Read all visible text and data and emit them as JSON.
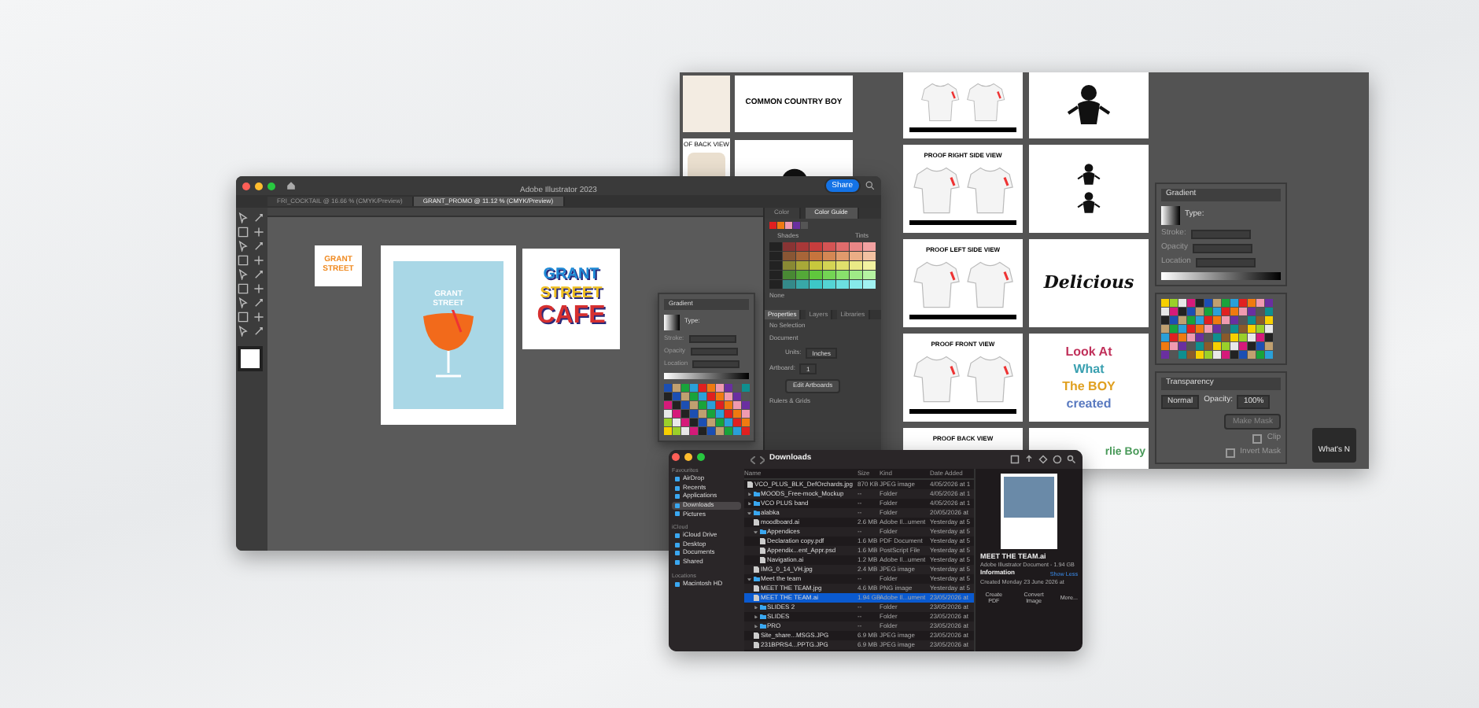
{
  "artboard_window": {
    "left_sheets": [
      {
        "kind": "title",
        "text": "COMMON COUNTRY BOY"
      },
      {
        "kind": "back",
        "text": "OF BACK VIEW"
      }
    ],
    "proof_sheets": [
      {
        "kind": "cut"
      },
      {
        "kind": "titled",
        "title": "PROOF RIGHT SIDE VIEW"
      },
      {
        "kind": "titled",
        "title": "PROOF LEFT SIDE VIEW"
      },
      {
        "kind": "titled",
        "title": "PROOF FRONT VIEW"
      },
      {
        "kind": "titled",
        "title": "PROOF BACK VIEW"
      }
    ],
    "art_sheets": [
      {
        "kind": "figure"
      },
      {
        "kind": "figures"
      },
      {
        "kind": "script",
        "lines": [
          "Delicious"
        ]
      },
      {
        "kind": "lettering",
        "lines": [
          "Look At",
          "What",
          "The BOY",
          "created"
        ]
      },
      {
        "kind": "cut-lettering",
        "lines": [
          "rlie Boy"
        ]
      }
    ],
    "gradient_panel": {
      "title": "Gradient",
      "labels": [
        "Type:",
        "Stroke:",
        "Opacity",
        "Location"
      ]
    },
    "transparency_panel": {
      "title": "Transparency",
      "blend": "Normal",
      "opacity_label": "Opacity:",
      "opacity": "100%",
      "make_mask": "Make Mask",
      "options": [
        {
          "label": "Clip",
          "checked": false
        },
        {
          "label": "Invert Mask",
          "checked": false
        }
      ]
    },
    "tooltip": "What's N"
  },
  "illustrator": {
    "title": "Adobe Illustrator 2023",
    "share": "Share",
    "tabs": [
      {
        "label": "FRI_COCKTAIL @ 16.66 % (CMYK/Preview)",
        "selected": false
      },
      {
        "label": "GRANT_PROMO @ 11.12 % (CMYK/Preview)",
        "selected": true
      }
    ],
    "artboards": [
      {
        "kind": "badge",
        "lines": [
          "GRANT",
          "STREET"
        ]
      },
      {
        "kind": "poster",
        "lines": [
          "GRANT",
          "STREET"
        ]
      },
      {
        "kind": "logo",
        "lines": [
          "GRANT",
          "STREET",
          "CAFE"
        ]
      }
    ],
    "color_tabs": [
      {
        "label": "Color",
        "selected": false
      },
      {
        "label": "Color Guide",
        "selected": true
      }
    ],
    "guide_labels": [
      "Shades",
      "Tints"
    ],
    "none_label": "None",
    "property_tabs": [
      {
        "label": "Properties",
        "selected": true
      },
      {
        "label": "Layers",
        "selected": false
      },
      {
        "label": "Libraries",
        "selected": false
      }
    ],
    "properties": {
      "selection": "No Selection",
      "section": "Document",
      "units_label": "Units:",
      "units": "Inches",
      "artboard_label": "Artboard:",
      "artboard": "1",
      "edit": "Edit Artboards",
      "rulers": "Rulers & Grids"
    },
    "gradient_float": {
      "title": "Gradient",
      "labels": [
        "Type:",
        "Stroke:",
        "Opacity",
        "Location"
      ]
    }
  },
  "finder": {
    "title": "Downloads",
    "sidebar": [
      {
        "heading": "Favourites",
        "items": [
          {
            "label": "AirDrop",
            "selected": false
          },
          {
            "label": "Recents",
            "selected": false
          },
          {
            "label": "Applications",
            "selected": false
          },
          {
            "label": "Downloads",
            "selected": true
          },
          {
            "label": "Pictures",
            "selected": false
          }
        ]
      },
      {
        "heading": "iCloud",
        "items": [
          {
            "label": "iCloud Drive",
            "selected": false
          },
          {
            "label": "Desktop",
            "selected": false
          },
          {
            "label": "Documents",
            "selected": false
          },
          {
            "label": "Shared",
            "selected": false
          }
        ]
      },
      {
        "heading": "Locations",
        "items": [
          {
            "label": "Macintosh HD",
            "selected": false
          }
        ]
      }
    ],
    "columns": [
      "Name",
      "Size",
      "Kind",
      "Date Added"
    ],
    "rows": [
      {
        "name": "VCO_PLUS_BLK_DefOrchards.jpg",
        "size": "870 KB",
        "type": "JPEG image",
        "date": "4/05/2026 at 1",
        "kind": "file",
        "selected": false
      },
      {
        "name": "MOODS_Free-mock_Mockup",
        "size": "--",
        "type": "Folder",
        "date": "4/05/2026 at 1",
        "kind": "folder",
        "expanded": false,
        "selected": false
      },
      {
        "name": "VCO PLUS band",
        "size": "--",
        "type": "Folder",
        "date": "4/05/2026 at 1",
        "kind": "folder",
        "expanded": false,
        "selected": false
      },
      {
        "name": "alabka",
        "size": "--",
        "type": "Folder",
        "date": "20/05/2026 at",
        "kind": "folder",
        "expanded": true,
        "selected": false,
        "children": [
          {
            "name": "moodboard.ai",
            "size": "2.6 MB",
            "type": "Adobe Il...ument",
            "date": "Yesterday at 5",
            "kind": "file",
            "selected": false
          },
          {
            "name": "Appendices",
            "size": "--",
            "type": "Folder",
            "date": "Yesterday at 5",
            "kind": "folder",
            "expanded": true,
            "selected": false,
            "children": [
              {
                "name": "Declaration copy.pdf",
                "size": "1.6 MB",
                "type": "PDF Document",
                "date": "Yesterday at 5",
                "kind": "file",
                "selected": false
              },
              {
                "name": "Appendix...ent_Appr.psd",
                "size": "1.6 MB",
                "type": "PostScript File",
                "date": "Yesterday at 5",
                "kind": "file",
                "selected": false
              },
              {
                "name": "Navigation.ai",
                "size": "1.2 MB",
                "type": "Adobe Il...ument",
                "date": "Yesterday at 5",
                "kind": "file",
                "selected": false
              }
            ]
          },
          {
            "name": "IMG_0_14_VH.jpg",
            "size": "2.4 MB",
            "type": "JPEG image",
            "date": "Yesterday at 5",
            "kind": "file",
            "selected": false
          }
        ]
      },
      {
        "name": "Meet the team",
        "size": "--",
        "type": "Folder",
        "date": "Yesterday at 5",
        "kind": "folder",
        "expanded": true,
        "selected": false,
        "children": [
          {
            "name": "MEET THE TEAM.jpg",
            "size": "4.6 MB",
            "type": "PNG image",
            "date": "Yesterday at 5",
            "kind": "file",
            "selected": false
          },
          {
            "name": "MEET THE TEAM.ai",
            "size": "1.94 GB",
            "type": "Adobe Il...ument",
            "date": "23/05/2026 at",
            "kind": "file",
            "selected": true
          },
          {
            "name": "SLIDES 2",
            "size": "--",
            "type": "Folder",
            "date": "23/05/2026 at",
            "kind": "folder",
            "expanded": false,
            "selected": false
          },
          {
            "name": "SLIDES",
            "size": "--",
            "type": "Folder",
            "date": "23/05/2026 at",
            "kind": "folder",
            "expanded": false,
            "selected": false
          },
          {
            "name": "PRO",
            "size": "--",
            "type": "Folder",
            "date": "23/05/2026 at",
            "kind": "folder",
            "expanded": false,
            "selected": false
          },
          {
            "name": "Site_share...MSGS.JPG",
            "size": "6.9 MB",
            "type": "JPEG image",
            "date": "23/05/2026 at",
            "kind": "file",
            "selected": false
          },
          {
            "name": "231BPRS4...PPTG.JPG",
            "size": "6.9 MB",
            "type": "JPEG image",
            "date": "23/05/2026 at",
            "kind": "file",
            "selected": false
          }
        ]
      }
    ],
    "preview": {
      "name": "MEET THE TEAM.ai",
      "info": "Adobe Illustrator Document - 1.94 GB",
      "section": "Information",
      "toggle": "Show Less",
      "created": "Created  Monday 23 June 2026 at",
      "actions": [
        "Create PDF",
        "Convert Image",
        "More..."
      ]
    }
  }
}
